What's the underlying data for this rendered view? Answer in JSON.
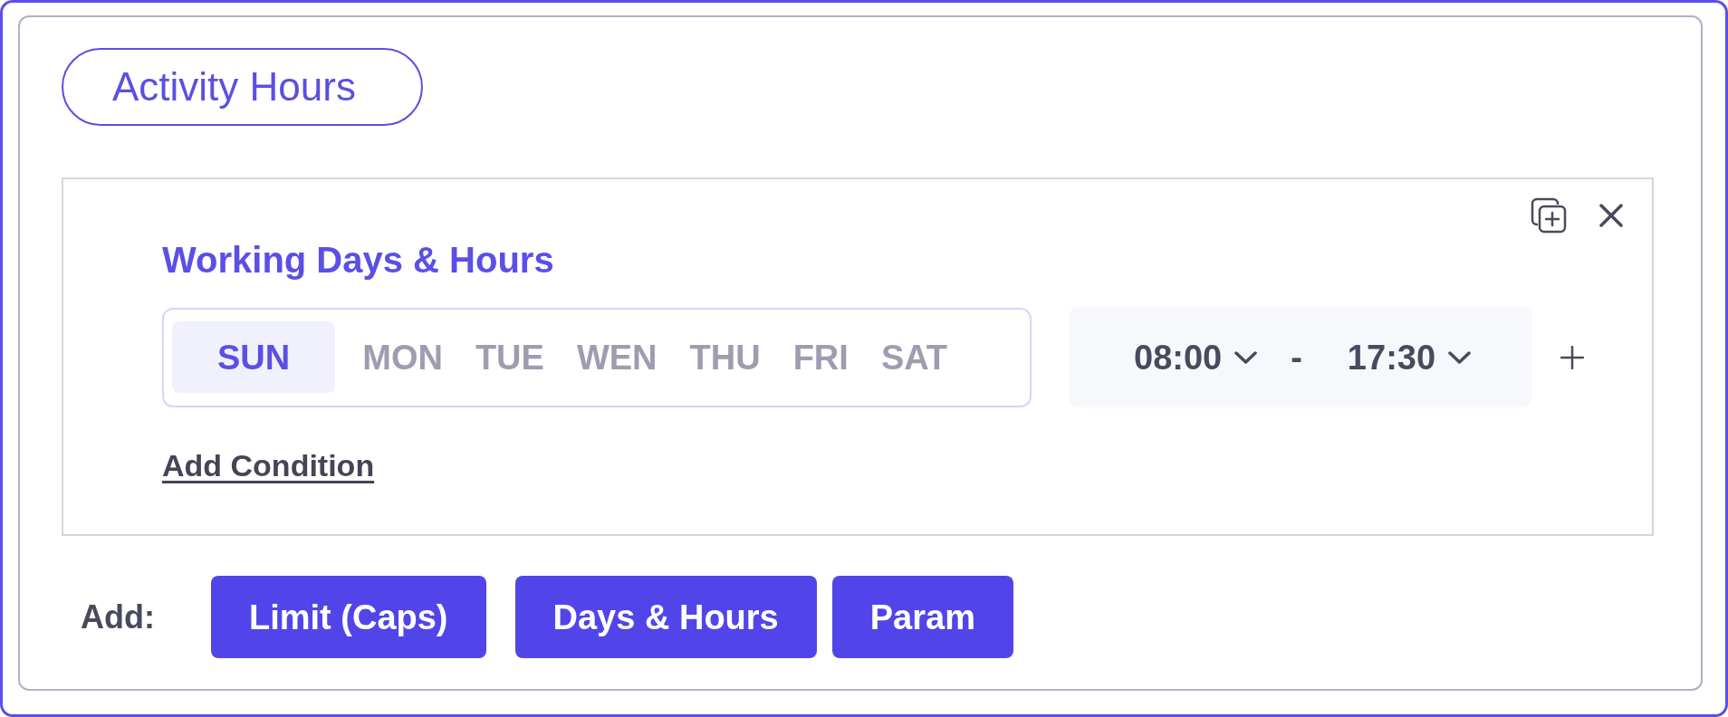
{
  "section": {
    "title": "Activity Hours"
  },
  "condition": {
    "title": "Working Days & Hours",
    "days": [
      {
        "label": "SUN",
        "selected": true
      },
      {
        "label": "MON",
        "selected": false
      },
      {
        "label": "TUE",
        "selected": false
      },
      {
        "label": "WEN",
        "selected": false
      },
      {
        "label": "THU",
        "selected": false
      },
      {
        "label": "FRI",
        "selected": false
      },
      {
        "label": "SAT",
        "selected": false
      }
    ],
    "time_range": {
      "start": "08:00",
      "separator": "-",
      "end": "17:30"
    },
    "add_condition": "Add Condition"
  },
  "add_bar": {
    "label": "Add:",
    "buttons": [
      "Limit (Caps)",
      "Days & Hours",
      "Param"
    ]
  }
}
